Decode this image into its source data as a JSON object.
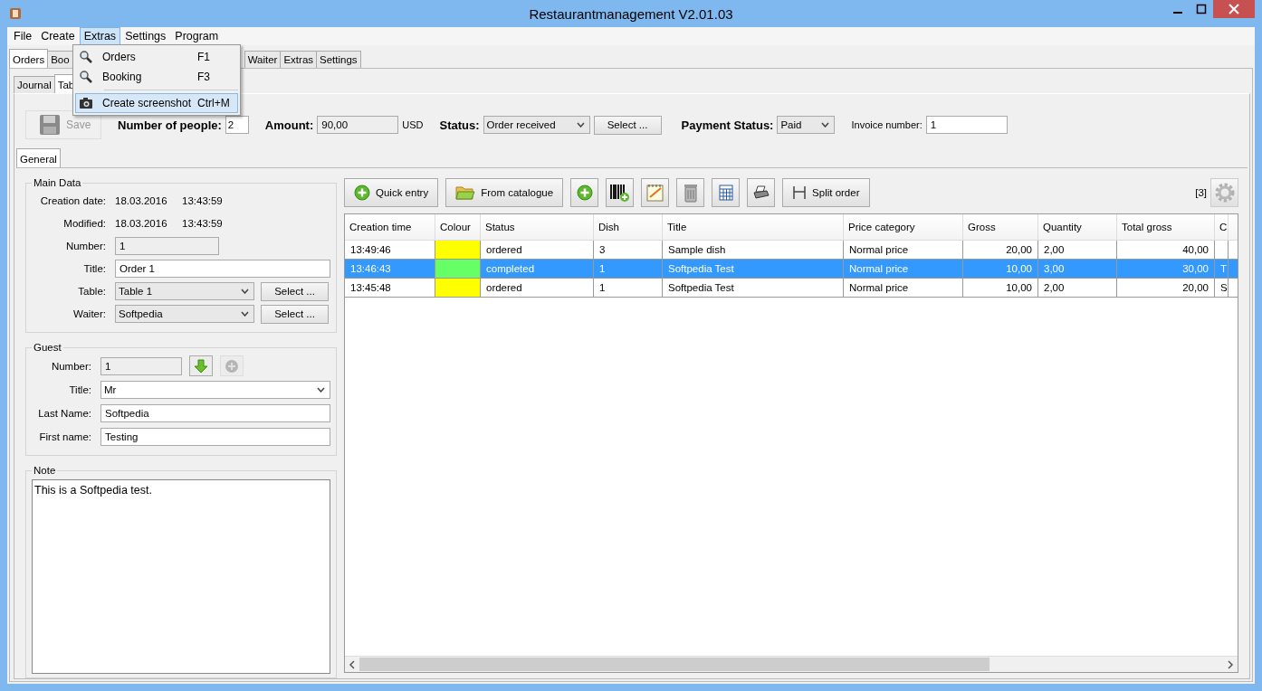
{
  "window": {
    "title": "Restaurantmanagement V2.01.03"
  },
  "menu_bar": [
    {
      "label": "File",
      "selected": false
    },
    {
      "label": "Create",
      "selected": false
    },
    {
      "label": "Extras",
      "selected": true
    },
    {
      "label": "Settings",
      "selected": false
    },
    {
      "label": "Program",
      "selected": false
    }
  ],
  "menu_popup": [
    {
      "kind": "item",
      "label": "Orders",
      "shortcut": "F1",
      "selected": false
    },
    {
      "kind": "item",
      "label": "Booking",
      "shortcut": "F3",
      "selected": false
    },
    {
      "kind": "separator"
    },
    {
      "kind": "item",
      "label": "Create screenshot",
      "shortcut": "Ctrl+M",
      "selected": true
    }
  ],
  "tabs": [
    {
      "label": "Orders",
      "selected": true
    },
    {
      "label": "Boo",
      "selected": false
    },
    {
      "label": "Waiter",
      "selected": false
    },
    {
      "label": "Extras",
      "selected": false
    },
    {
      "label": "Settings",
      "selected": false
    }
  ],
  "sub_tabs": [
    {
      "label": "Journal",
      "selected": false
    },
    {
      "label": "Tab",
      "selected": true
    }
  ],
  "order_header": {
    "save_button": {
      "label": "Save",
      "disabled": true
    },
    "number_of_people": {
      "label": "Number of people:",
      "value": "2"
    },
    "amount": {
      "label": "Amount:",
      "value": "90,00",
      "currency": "USD"
    },
    "status": {
      "label": "Status:",
      "value": "Order received",
      "button": "Select ..."
    },
    "payment_status": {
      "label": "Payment Status:",
      "value": "Paid"
    },
    "invoice_number": {
      "label": "Invoice number:",
      "value": "1"
    }
  },
  "detail_tabs": [
    {
      "label": "General",
      "selected": true
    }
  ],
  "main_data": {
    "title": "Main Data",
    "creation_date": {
      "label": "Creation date:",
      "date": "18.03.2016",
      "time": "13:43:59"
    },
    "modified": {
      "label": "Modified:",
      "date": "18.03.2016",
      "time": "13:43:59"
    },
    "number": {
      "label": "Number:",
      "value": "1"
    },
    "title_field": {
      "label": "Title:",
      "value": "Order 1"
    },
    "table": {
      "label": "Table:",
      "value": "Table 1",
      "button": "Select ..."
    },
    "waiter": {
      "label": "Waiter:",
      "value": "Softpedia",
      "button": "Select ..."
    }
  },
  "guest": {
    "title": "Guest",
    "number": {
      "label": "Number:",
      "value": "1"
    },
    "title_field": {
      "label": "Title:",
      "value": "Mr"
    },
    "last_name": {
      "label": "Last Name:",
      "value": "Softpedia"
    },
    "first_name": {
      "label": "First name:",
      "value": "Testing"
    }
  },
  "note": {
    "title": "Note",
    "text": "This is a Softpedia test."
  },
  "toolbar": [
    {
      "kind": "text",
      "label": "Quick entry"
    },
    {
      "kind": "text",
      "label": "From catalogue"
    },
    {
      "kind": "icon"
    },
    {
      "kind": "icon"
    },
    {
      "kind": "icon"
    },
    {
      "kind": "icon"
    },
    {
      "kind": "icon"
    },
    {
      "kind": "icon"
    },
    {
      "kind": "text",
      "label": "Split order"
    }
  ],
  "item_count": "[3]",
  "table": {
    "columns": [
      {
        "label": "Creation time",
        "kind": "text"
      },
      {
        "label": "Colour",
        "kind": "color"
      },
      {
        "label": "Status",
        "kind": "text"
      },
      {
        "label": "Dish",
        "kind": "text"
      },
      {
        "label": "Title",
        "kind": "text"
      },
      {
        "label": "Price category",
        "kind": "text"
      },
      {
        "label": "Gross",
        "kind": "number"
      },
      {
        "label": "Quantity",
        "kind": "text"
      },
      {
        "label": "Total gross",
        "kind": "number"
      },
      {
        "label": "C",
        "kind": "text"
      }
    ],
    "rows": [
      {
        "selected": false,
        "color": "#ffff00",
        "cells": [
          "13:49:46",
          "",
          "ordered",
          "3",
          "Sample dish",
          "Normal price",
          "20,00",
          "2,00",
          "40,00",
          ""
        ]
      },
      {
        "selected": true,
        "color": "#66ff66",
        "cells": [
          "13:46:43",
          "",
          "completed",
          "1",
          "Softpedia Test",
          "Normal price",
          "10,00",
          "3,00",
          "30,00",
          "T"
        ]
      },
      {
        "selected": false,
        "color": "#ffff00",
        "cells": [
          "13:45:48",
          "",
          "ordered",
          "1",
          "Softpedia Test",
          "Normal price",
          "10,00",
          "2,00",
          "20,00",
          "S"
        ]
      }
    ]
  }
}
